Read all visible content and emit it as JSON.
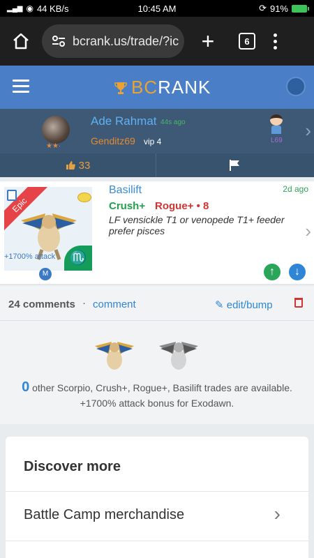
{
  "status": {
    "left_text": "44 KB/s",
    "time": "10:45 AM",
    "battery": "91%"
  },
  "browser": {
    "url": "bcrank.us/trade/?ic",
    "tab_count": "6"
  },
  "site": {
    "brand_bc": "BC",
    "brand_rank": "RANK"
  },
  "user": {
    "name": "Ade Rahmat",
    "time_ago": "44s ago",
    "trader_name": "Genditz69",
    "vip": "vip 4",
    "level": "L69",
    "likes": "33",
    "stars": "★★·"
  },
  "trade": {
    "rarity": "Epic",
    "title": "Basilift",
    "time_ago": "2d ago",
    "crush": "Crush+",
    "rogue": "Rogue+ • 8",
    "note": "LF vensickle T1 or venopede T1+ feeder prefer pisces",
    "attack": "+1700% attack",
    "badge": "M",
    "zodiac_symbol": "♏"
  },
  "comments": {
    "count": "24 comments",
    "dot": "·",
    "comment_link": "comment",
    "edit_bump": "edit/bump"
  },
  "available": {
    "count": "0",
    "text": " other Scorpio, Crush+, Rogue+, Basilift trades are available.",
    "bonus": "+1700% attack bonus for Exodawn."
  },
  "discover": {
    "title": "Discover more",
    "item_label": "Battle Camp merchandise"
  },
  "colors": {
    "header_blue": "#4a7ec6",
    "userbar": "#3d5975",
    "crush_green": "#23a04c",
    "rogue_red": "#d23434",
    "epic_red": "#e54347",
    "link_blue": "#2f86d6"
  }
}
